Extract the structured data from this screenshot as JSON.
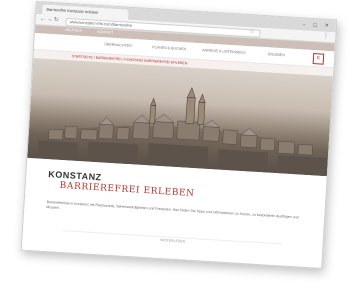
{
  "browser": {
    "tab_title": "Barrierefrei Konstanz erleben",
    "url": "www.konstanz-info.com/barrierefrei",
    "window_controls": "– ▢ ✕",
    "icons": [
      "back-icon",
      "forward-icon",
      "reload-icon",
      "star-icon",
      "menu-icon"
    ]
  },
  "site": {
    "topbar_left": "DEUTSCH",
    "topbar_right": "KONTAKT",
    "nav": [
      "ÜBERNACHTEN",
      "PLANEN & BUCHEN",
      "ANREISE & UNTERWEGS",
      "ERLEBEN"
    ],
    "logo_glyph": "K",
    "breadcrumb": "STARTSEITE / BARRIEREFREI / KONSTANZ BARRIEREFREI ERLEBEN"
  },
  "content": {
    "title": "KONSTANZ",
    "subtitle": "BARRIEREFREI ERLEBEN",
    "intro": "Barrierefreiheit in Konstanz mit Restaurants, Sehenswürdigkeiten und Freizeiten. Hier finden Sie Tipps und Informationen zu Touren, zu besonderen Ausflügen und Museen.",
    "more_label": "WEITERLESEN"
  },
  "colors": {
    "accent": "#b8312f",
    "topbar": "#cdbfb8"
  }
}
